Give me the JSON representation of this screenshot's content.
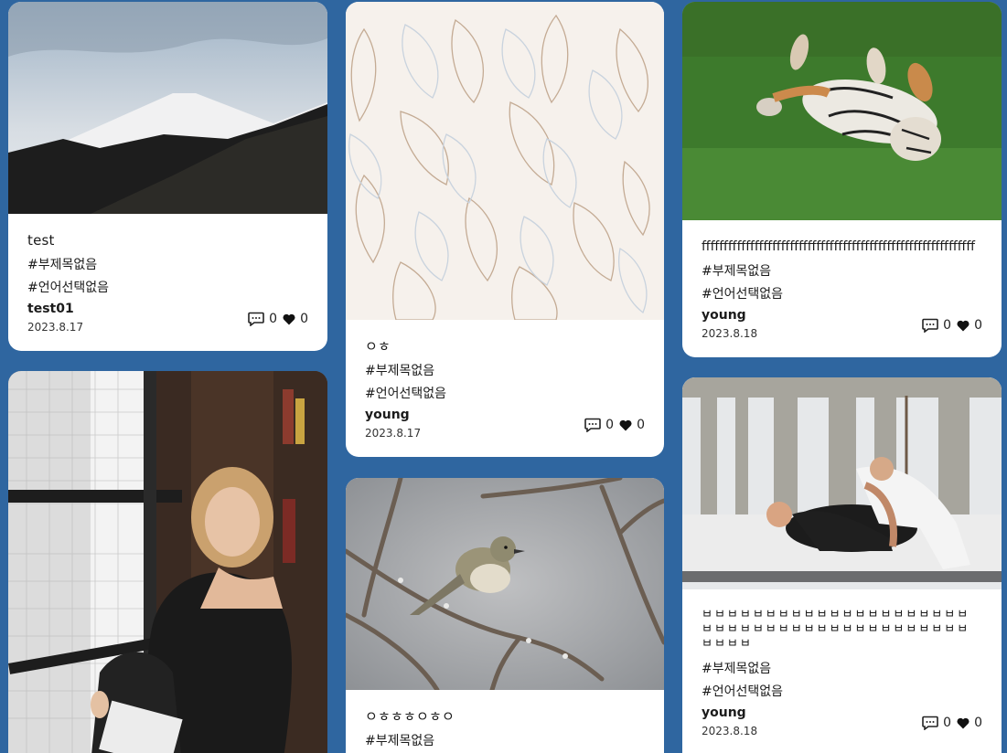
{
  "posts": [
    {
      "title": "test",
      "tag_subject": "#부제목없음",
      "tag_language": "#언어선택없음",
      "author": "test01",
      "date": "2023.8.17",
      "comments": "0",
      "likes": "0",
      "image": "snowy-mountain"
    },
    {
      "title": "ㅇㅎ",
      "tag_subject": "#부제목없음",
      "tag_language": "#언어선택없음",
      "author": "young",
      "date": "2023.8.17",
      "comments": "0",
      "likes": "0",
      "image": "leaf-pattern"
    },
    {
      "title": "ffffffffffffffffffffffffffffffffffffffffffffffffffffffffffffff",
      "tag_subject": "#부제목없음",
      "tag_language": "#언어선택없음",
      "author": "young",
      "date": "2023.8.18",
      "comments": "0",
      "likes": "0",
      "image": "tiger-on-grass"
    },
    {
      "image": "woman-reading-by-window"
    },
    {
      "title": "ㅇㅎㅎㅎㅇㅎㅇ",
      "tag_subject": "#부제목없음",
      "image": "bird-on-branch"
    },
    {
      "title": "ㅂㅂㅂㅂㅂㅂㅂㅂㅂㅂㅂㅂㅂㅂㅂㅂㅂㅂㅂㅂㅂㅂㅂㅂㅂㅂㅂㅂㅂㅂㅂㅂㅂㅂㅂㅂㅂㅂㅂㅂㅂㅂㅂㅂㅂㅂ",
      "tag_subject": "#부제목없음",
      "tag_language": "#언어선택없음",
      "author": "young",
      "date": "2023.8.18",
      "comments": "0",
      "likes": "0",
      "image": "jiujitsu-under-bridge"
    }
  ],
  "colors": {
    "background": "#2f66a0",
    "card": "#ffffff"
  }
}
